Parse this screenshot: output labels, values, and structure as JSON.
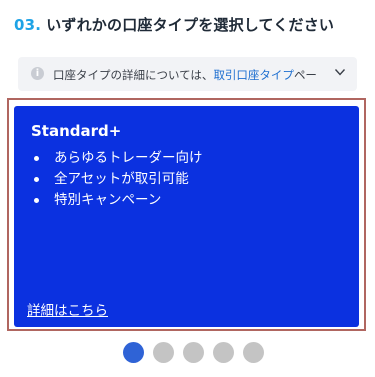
{
  "step": {
    "number": "03.",
    "title": "いずれかの口座タイプを選択してください"
  },
  "info": {
    "icon": "info-icon",
    "text_prefix": "口座タイプの詳細については、",
    "link_text": "取引口座タイプ",
    "text_suffix": "ペー",
    "expand_icon": "chevron-down-icon"
  },
  "card": {
    "title": "Standard+",
    "features": [
      "あらゆるトレーダー向け",
      "全アセットが取引可能",
      "特別キャンペーン"
    ],
    "details_link": "詳細はこちら",
    "background_color": "#0b31e0"
  },
  "pagination": {
    "total": 5,
    "active_index": 0,
    "active_color": "#2f63d6",
    "inactive_color": "#c4c4c4"
  }
}
